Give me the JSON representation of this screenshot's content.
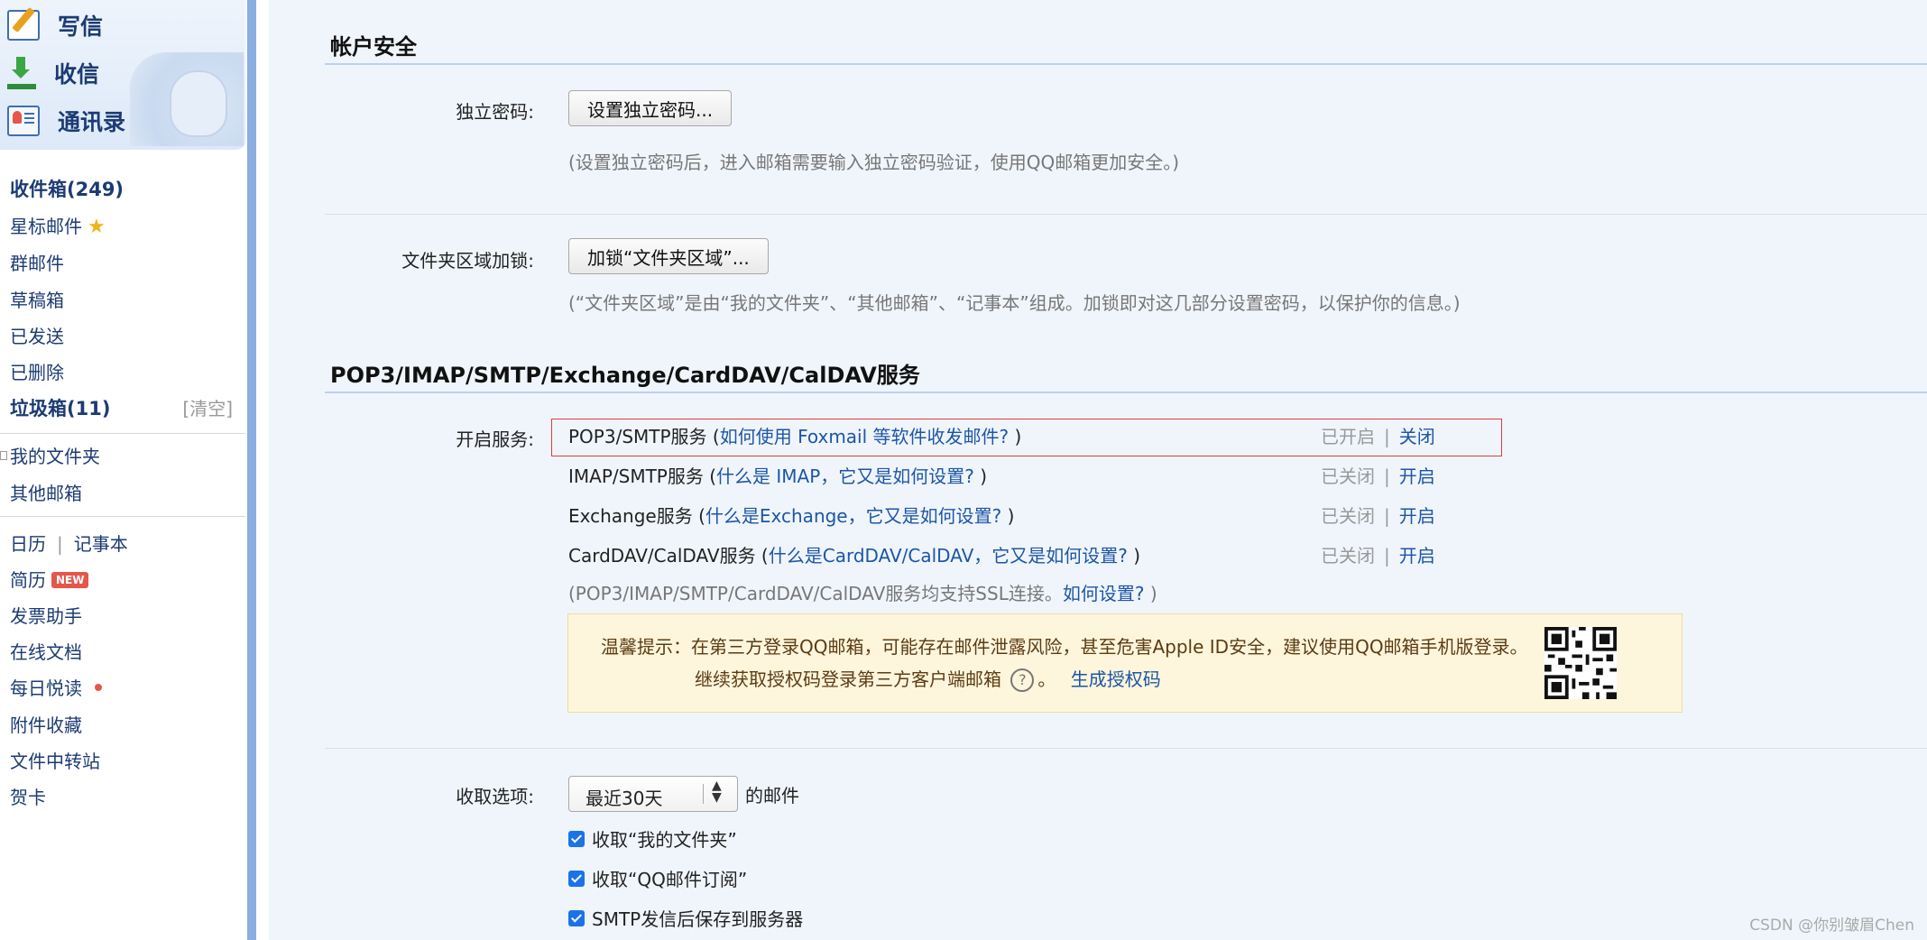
{
  "sidebar": {
    "actions": {
      "compose": "写信",
      "receive": "收信",
      "contacts": "通讯录"
    },
    "folders": {
      "inbox": "收件箱(249)",
      "starred": "星标邮件",
      "group": "群邮件",
      "drafts": "草稿箱",
      "sent": "已发送",
      "deleted": "已删除",
      "spam": "垃圾箱(11)",
      "spam_clear": "[清空]",
      "my_folders": "我的文件夹",
      "other_mailboxes": "其他邮箱"
    },
    "apps": {
      "calendar": "日历",
      "separator": "|",
      "notepad": "记事本",
      "resume": "简历",
      "new_badge": "NEW",
      "invoice": "发票助手",
      "online_docs": "在线文档",
      "daily_read": "每日悦读",
      "attachments": "附件收藏",
      "file_transfer": "文件中转站",
      "cards": "贺卡"
    }
  },
  "account_security": {
    "title": "帐户安全",
    "password_label": "独立密码:",
    "password_button": "设置独立密码...",
    "password_hint": "(设置独立密码后，进入邮箱需要输入独立密码验证，使用QQ邮箱更加安全。)",
    "folder_lock_label": "文件夹区域加锁:",
    "folder_lock_button": "加锁“文件夹区域”...",
    "folder_lock_hint": "(“文件夹区域”是由“我的文件夹”、“其他邮箱”、“记事本”组成。加锁即对这几部分设置密码，以保护你的信息。)"
  },
  "services": {
    "title": "POP3/IMAP/SMTP/Exchange/CardDAV/CalDAV服务",
    "enable_label": "开启服务:",
    "rows": [
      {
        "name": "POP3/SMTP服务 (",
        "link": "如何使用 Foxmail 等软件收发邮件?",
        "close": " )",
        "status": "已开启",
        "bar": "|",
        "action": "关闭"
      },
      {
        "name": "IMAP/SMTP服务 (",
        "link": "什么是 IMAP，它又是如何设置?",
        "close": " )",
        "status": "已关闭",
        "bar": "|",
        "action": "开启"
      },
      {
        "name": "Exchange服务 (",
        "link": "什么是Exchange，它又是如何设置?",
        "close": " )",
        "status": "已关闭",
        "bar": "|",
        "action": "开启"
      },
      {
        "name": "CardDAV/CalDAV服务 (",
        "link": "什么是CardDAV/CalDAV，它又是如何设置?",
        "close": " )",
        "status": "已关闭",
        "bar": "|",
        "action": "开启"
      }
    ],
    "ssl_note": "(POP3/IMAP/SMTP/CardDAV/CalDAV服务均支持SSL连接。",
    "ssl_link": "如何设置?",
    "ssl_close": " )",
    "tip_line1": "温馨提示：在第三方登录QQ邮箱，可能存在邮件泄露风险，甚至危害Apple ID安全，建议使用QQ邮箱手机版登录。",
    "tip_line2": "继续获取授权码登录第三方客户端邮箱",
    "tip_question": "?",
    "tip_period": "。",
    "tip_link": "生成授权码"
  },
  "receive_options": {
    "label": "收取选项:",
    "select_value": "最近30天",
    "select_suffix": "的邮件",
    "checkboxes": [
      {
        "label": "收取“我的文件夹”",
        "checked": true
      },
      {
        "label": "收取“QQ邮件订阅”",
        "checked": true
      },
      {
        "label": "SMTP发信后保存到服务器",
        "checked": true
      }
    ]
  },
  "watermark": "CSDN @你别皱眉Chen",
  "colors": {
    "link": "#1d56a5",
    "highlight_border": "#e23b3b",
    "tip_background": "#fdf6dc",
    "checkbox": "#1a73e8"
  }
}
